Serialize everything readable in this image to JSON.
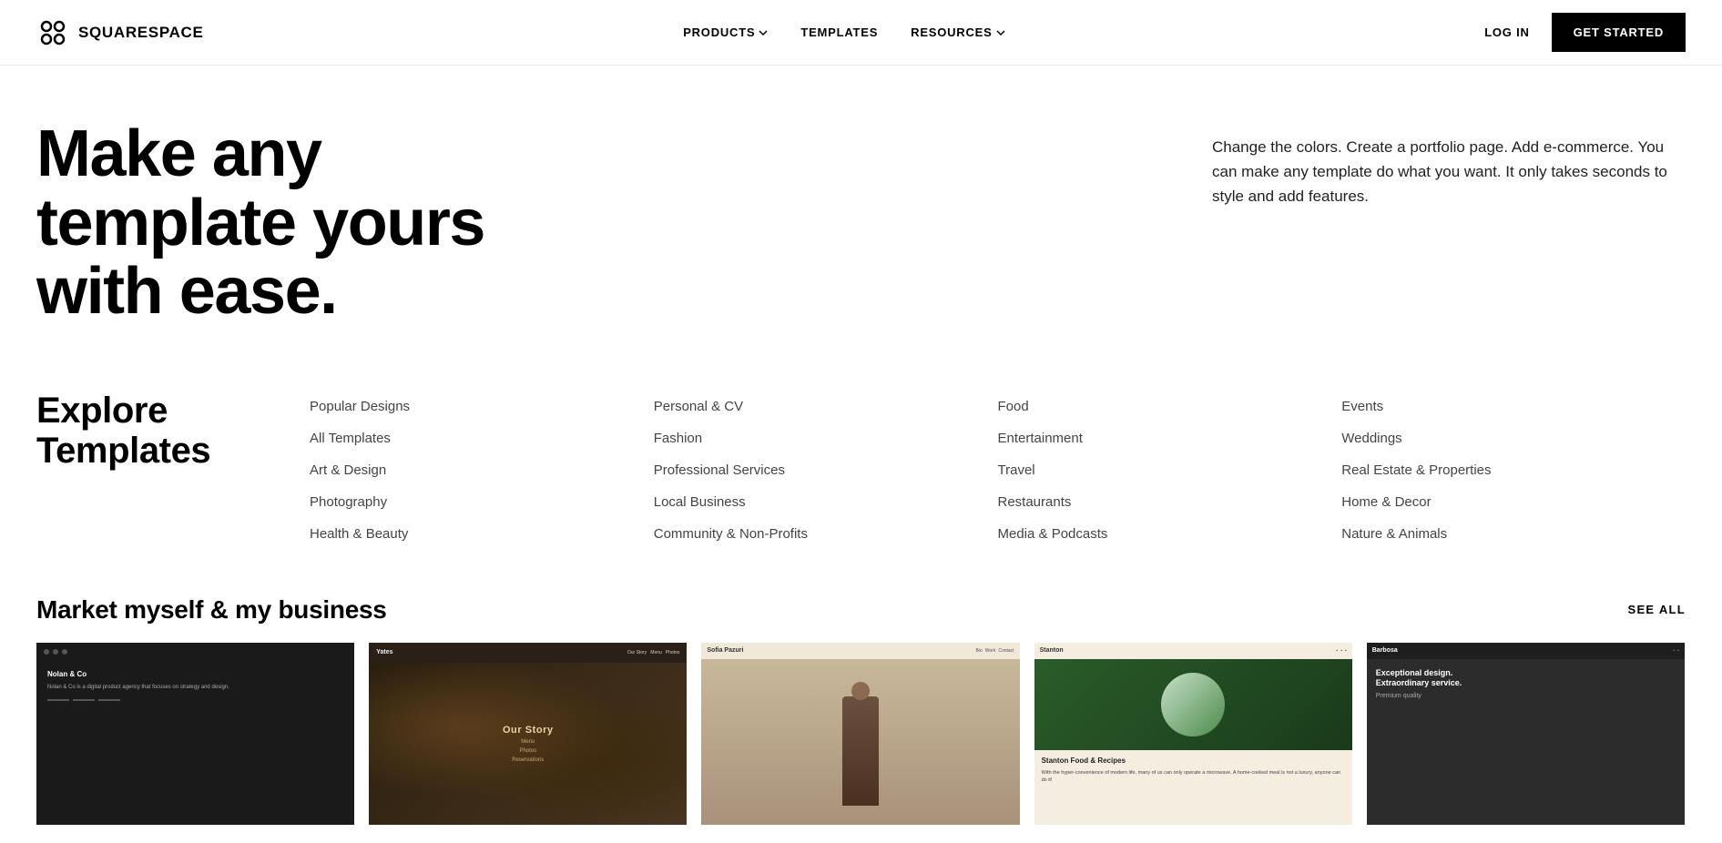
{
  "brand": {
    "name": "SQUARESPACE",
    "logo_alt": "Squarespace logo"
  },
  "nav": {
    "products_label": "PRODUCTS",
    "templates_label": "TEMPLATES",
    "resources_label": "RESOURCES",
    "login_label": "LOG IN",
    "cta_label": "GET STARTED"
  },
  "hero": {
    "title": "Make any template yours with ease.",
    "description": "Change the colors. Create a portfolio page. Add e-commerce. You can make any template do what you want. It only takes seconds to style and add features."
  },
  "explore": {
    "heading_line1": "Explore",
    "heading_line2": "Templates",
    "categories": {
      "col1": [
        {
          "label": "Popular Designs"
        },
        {
          "label": "All Templates"
        },
        {
          "label": "Art & Design"
        },
        {
          "label": "Photography"
        },
        {
          "label": "Health & Beauty"
        }
      ],
      "col2": [
        {
          "label": "Personal & CV"
        },
        {
          "label": "Fashion"
        },
        {
          "label": "Professional Services"
        },
        {
          "label": "Local Business"
        },
        {
          "label": "Community & Non-Profits"
        }
      ],
      "col3": [
        {
          "label": "Food"
        },
        {
          "label": "Entertainment"
        },
        {
          "label": "Travel"
        },
        {
          "label": "Restaurants"
        },
        {
          "label": "Media & Podcasts"
        }
      ],
      "col4": [
        {
          "label": "Events"
        },
        {
          "label": "Weddings"
        },
        {
          "label": "Real Estate & Properties"
        },
        {
          "label": "Home & Decor"
        },
        {
          "label": "Nature & Animals"
        }
      ]
    }
  },
  "market_section": {
    "title": "Market myself & my business",
    "see_all_label": "SEE ALL"
  },
  "thumbnails": [
    {
      "name": "Nolan & Co",
      "type": "dark",
      "tagline": "Nolan & Co is a digital product agency that focuses on strategy and design."
    },
    {
      "name": "Yates",
      "type": "food-dark",
      "tagline": ""
    },
    {
      "name": "Sofia Pazuri",
      "type": "neutral",
      "tagline": ""
    },
    {
      "name": "Stanton",
      "type": "light",
      "tagline": "Stanton Food & Recipes. With the hyper-convenience of modern life, many of us can only operate a microwave. A home-cooked meal is not a luxury, anyone can do it!"
    },
    {
      "name": "Barbosa",
      "type": "dark2",
      "tagline": "Exceptional design. Extraordinary service."
    }
  ]
}
